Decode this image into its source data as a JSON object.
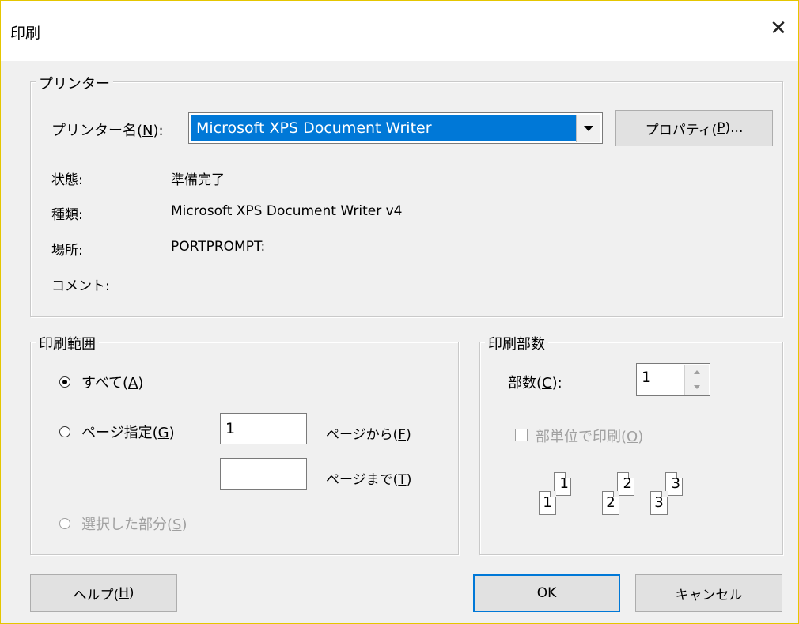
{
  "window": {
    "title": "印刷",
    "close_label": "✕"
  },
  "printer": {
    "group_label": "プリンター",
    "name_label_pre": "プリンター名(",
    "name_label_key": "N",
    "name_label_post": "):",
    "selected_printer": "Microsoft XPS Document Writer",
    "properties_pre": "プロパティ(",
    "properties_key": "P",
    "properties_post": ")...",
    "status_label": "状態:",
    "status_value": "準備完了",
    "type_label": "種類:",
    "type_value": "Microsoft XPS Document Writer v4",
    "location_label": "場所:",
    "location_value": "PORTPROMPT:",
    "comment_label": "コメント:",
    "comment_value": ""
  },
  "range": {
    "group_label": "印刷範囲",
    "all_pre": "すべて(",
    "all_key": "A",
    "all_post": ")",
    "pages_pre": "ページ指定(",
    "pages_key": "G",
    "pages_post": ")",
    "from_value": "1",
    "from_pre": "ページから(",
    "from_key": "F",
    "from_post": ")",
    "to_value": "",
    "to_pre": "ページまで(",
    "to_key": "T",
    "to_post": ")",
    "selection_pre": "選択した部分(",
    "selection_key": "S",
    "selection_post": ")",
    "selected_option": "all"
  },
  "copies": {
    "group_label": "印刷部数",
    "count_pre": "部数(",
    "count_key": "C",
    "count_post": "):",
    "count_value": "1",
    "collate_pre": "部単位で印刷(",
    "collate_key": "O",
    "collate_post": ")",
    "collate_checked": false,
    "collate_pages": [
      "1",
      "1",
      "2",
      "2",
      "3",
      "3"
    ]
  },
  "buttons": {
    "help_pre": "ヘルプ(",
    "help_key": "H",
    "help_post": ")",
    "ok": "OK",
    "cancel": "キャンセル"
  },
  "colors": {
    "selection": "#0078d7",
    "window_border": "#e5c600",
    "disabled_text": "#a0a0a0"
  }
}
